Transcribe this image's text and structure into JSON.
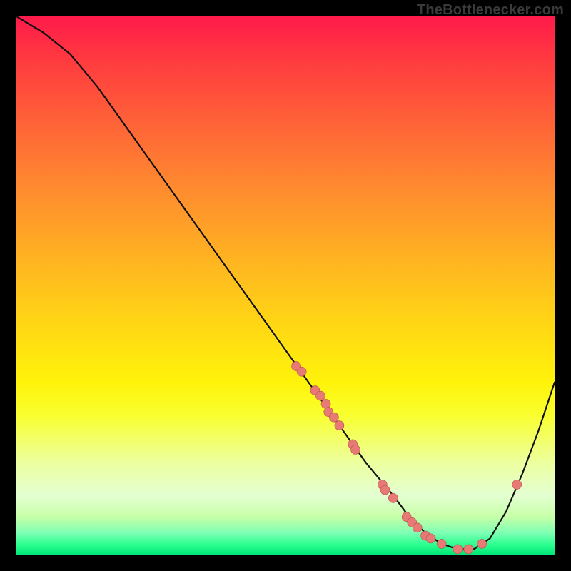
{
  "watermark": "TheBottlenecker.com",
  "chart_data": {
    "type": "line",
    "title": "",
    "xlabel": "",
    "ylabel": "",
    "xlim": [
      0,
      100
    ],
    "ylim": [
      0,
      100
    ],
    "curve": {
      "x": [
        0,
        5,
        10,
        15,
        20,
        25,
        30,
        35,
        40,
        45,
        50,
        55,
        60,
        65,
        70,
        73,
        76,
        79,
        82,
        85,
        88,
        91,
        94,
        97,
        100
      ],
      "y": [
        100,
        97,
        93,
        87,
        80,
        73,
        66,
        59,
        52,
        45,
        38,
        31,
        24,
        17,
        11,
        7,
        4,
        2,
        1,
        1,
        3,
        8,
        15,
        23,
        32
      ]
    },
    "points": [
      {
        "x": 52,
        "y": 35
      },
      {
        "x": 53,
        "y": 34
      },
      {
        "x": 55.5,
        "y": 30.5
      },
      {
        "x": 56.5,
        "y": 29.5
      },
      {
        "x": 57.5,
        "y": 28
      },
      {
        "x": 58,
        "y": 26.5
      },
      {
        "x": 59,
        "y": 25.5
      },
      {
        "x": 60,
        "y": 24
      },
      {
        "x": 62.5,
        "y": 20.5
      },
      {
        "x": 63,
        "y": 19.5
      },
      {
        "x": 68.0,
        "y": 13
      },
      {
        "x": 68.5,
        "y": 12
      },
      {
        "x": 70,
        "y": 10.5
      },
      {
        "x": 72.5,
        "y": 7
      },
      {
        "x": 73.5,
        "y": 6
      },
      {
        "x": 74.5,
        "y": 5
      },
      {
        "x": 76,
        "y": 3.5
      },
      {
        "x": 77,
        "y": 3
      },
      {
        "x": 79,
        "y": 2
      },
      {
        "x": 82,
        "y": 1
      },
      {
        "x": 84,
        "y": 1
      },
      {
        "x": 86.5,
        "y": 2
      },
      {
        "x": 93,
        "y": 13
      }
    ],
    "point_color": "#e77a74"
  }
}
